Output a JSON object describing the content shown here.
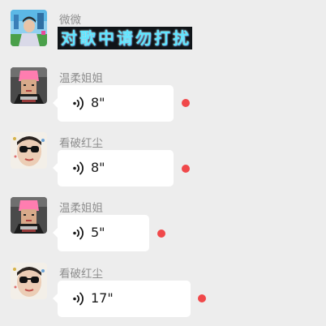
{
  "messages": [
    {
      "sender": "微微",
      "type": "sticker",
      "sticker_text": "对歌中请勿打扰"
    },
    {
      "sender": "温柔姐姐",
      "type": "voice",
      "duration": "8\"",
      "unread": true
    },
    {
      "sender": "看破红尘",
      "type": "voice",
      "duration": "8\"",
      "unread": true
    },
    {
      "sender": "温柔姐姐",
      "type": "voice",
      "duration": "5\"",
      "unread": true
    },
    {
      "sender": "看破红尘",
      "type": "voice",
      "duration": "17\"",
      "unread": true
    }
  ],
  "colors": {
    "background": "#ededed",
    "bubble": "#ffffff",
    "unread_dot": "#f0484a",
    "sender_name": "#8e8e8e"
  },
  "icons": {
    "voice": "voice-waves-icon"
  }
}
